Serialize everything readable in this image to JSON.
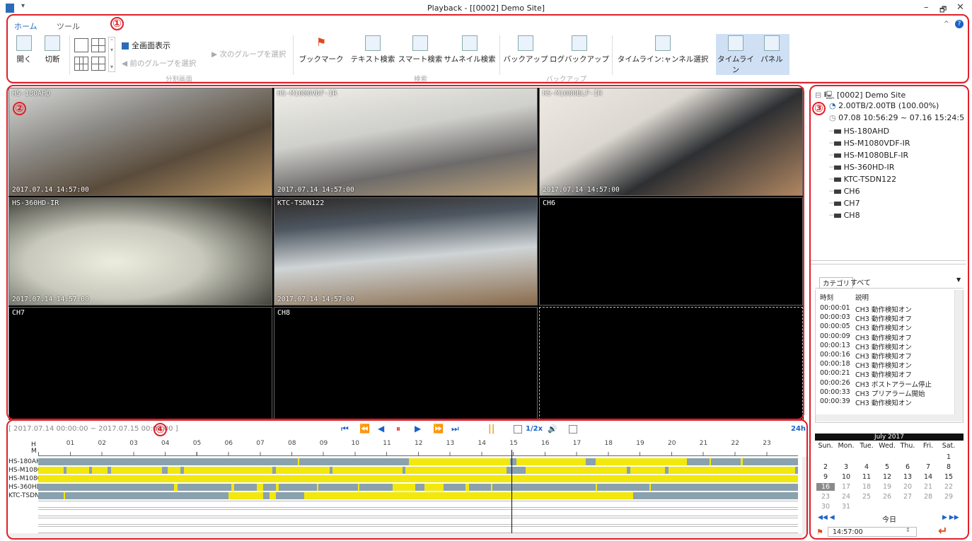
{
  "window": {
    "title": "Playback - [[0002] Demo Site]",
    "qa": "▾",
    "min": "–",
    "max": "🗗",
    "close": "✕"
  },
  "tabs": [
    {
      "label": "ホーム"
    },
    {
      "label": "ツール"
    }
  ],
  "ribbon": {
    "open": "開く",
    "disconnect": "切断",
    "fullscreen": "全画面表示",
    "prev_group": "前のグループを選択",
    "next_group": "次のグループを選択",
    "split_group": "分割画面",
    "bookmark": "ブックマーク",
    "text_search": "テキスト検索",
    "smart_search": "スマート検索",
    "thumb_search": "サムネイル検索",
    "search_group": "検索",
    "backup": "バックアップ",
    "log_backup": "ログバックアップ",
    "backup_group": "バックアップ",
    "timeline_channel": "タイムライン:ャンネル選択",
    "timeline": "タイムライン",
    "panel": "パネル"
  },
  "markers": [
    "①",
    "②",
    "③",
    "④"
  ],
  "tiles": [
    {
      "name": "HS-180AHD",
      "ts": "2017.07.14 14:57:00"
    },
    {
      "name": "HS-M1080VDF-IR",
      "ts": "2017.07.14 14:57:00"
    },
    {
      "name": "HS-M1080BLF-IR",
      "ts": "2017.07.14 14:57:00"
    },
    {
      "name": "HS-360HD-IR",
      "ts": "2017.07.14 14:57:00"
    },
    {
      "name": "KTC-TSDN122",
      "ts": "2017.07.14 14:57:00"
    },
    {
      "name": "CH6",
      "ts": ""
    },
    {
      "name": "CH7",
      "ts": ""
    },
    {
      "name": "CH8",
      "ts": ""
    },
    {
      "name": "",
      "ts": ""
    }
  ],
  "tree": {
    "site": "[0002] Demo Site",
    "storage": "2.00TB/2.00TB (100.00%)",
    "range": "07.08 10:56:29 ~ 07.16 15:24:5",
    "cameras": [
      "HS-180AHD",
      "HS-M1080VDF-IR",
      "HS-M1080BLF-IR",
      "HS-360HD-IR",
      "KTC-TSDN122",
      "CH6",
      "CH7",
      "CH8"
    ]
  },
  "events": {
    "category_label": "カテゴリ",
    "category_value": "すべて",
    "col_time": "時刻",
    "col_desc": "説明",
    "rows": [
      {
        "t": "00:00:01",
        "d": "CH3 動作検知オン"
      },
      {
        "t": "00:00:03",
        "d": "CH3 動作検知オフ"
      },
      {
        "t": "00:00:05",
        "d": "CH3 動作検知オン"
      },
      {
        "t": "00:00:09",
        "d": "CH3 動作検知オフ"
      },
      {
        "t": "00:00:13",
        "d": "CH3 動作検知オン"
      },
      {
        "t": "00:00:16",
        "d": "CH3 動作検知オフ"
      },
      {
        "t": "00:00:18",
        "d": "CH3 動作検知オン"
      },
      {
        "t": "00:00:21",
        "d": "CH3 動作検知オフ"
      },
      {
        "t": "00:00:26",
        "d": "CH3 ポストアラーム停止"
      },
      {
        "t": "00:00:33",
        "d": "CH3 プリアラーム開始"
      },
      {
        "t": "00:00:39",
        "d": "CH3 動作検知オン"
      }
    ]
  },
  "calendar": {
    "month": "July 2017",
    "dows": [
      "Sun.",
      "Mon.",
      "Tue.",
      "Wed.",
      "Thu.",
      "Fri.",
      "Sat."
    ],
    "weeks": [
      [
        "",
        "",
        "",
        "",
        "",
        "",
        "1"
      ],
      [
        "2",
        "3",
        "4",
        "5",
        "6",
        "7",
        "8"
      ],
      [
        "9",
        "10",
        "11",
        "12",
        "13",
        "14",
        "15"
      ],
      [
        "16",
        "17",
        "18",
        "19",
        "20",
        "21",
        "22"
      ],
      [
        "23",
        "24",
        "25",
        "26",
        "27",
        "28",
        "29"
      ],
      [
        "30",
        "31",
        "",
        "",
        "",
        "",
        ""
      ]
    ],
    "selected": "16",
    "today": "今日",
    "time": "14:57:00"
  },
  "playback": {
    "range": "[ 2017.07.14 00:00:00 ~ 2017.07.15 00:00:00 ]",
    "speed": "1/2x",
    "span": "24h",
    "buttons": [
      "⏮",
      "⏪",
      "◀",
      "⏸",
      "▶",
      "⏩",
      "⏭"
    ]
  },
  "timeline": {
    "hm_h": "H",
    "hm_m": "M",
    "hours": [
      "01",
      "02",
      "03",
      "04",
      "05",
      "06",
      "07",
      "08",
      "09",
      "10",
      "11",
      "12",
      "13",
      "14",
      "15",
      "16",
      "17",
      "18",
      "19",
      "20",
      "21",
      "22",
      "23"
    ],
    "tracks": [
      {
        "label": "HS-180AHD",
        "segs": [
          [
            8.2,
            8.25
          ],
          [
            11.7,
            14.9
          ],
          [
            15.1,
            17.3
          ],
          [
            17.6,
            20.5
          ],
          [
            21.2,
            21.25
          ],
          [
            22.2,
            22.25
          ]
        ]
      },
      {
        "label": "HS-M1080VDF-IR",
        "segs": [
          [
            0,
            0.8
          ],
          [
            0.9,
            1.6
          ],
          [
            1.7,
            2.2
          ],
          [
            2.3,
            3.9
          ],
          [
            4.1,
            4.5
          ],
          [
            4.6,
            7.4
          ],
          [
            7.5,
            9.2
          ],
          [
            9.3,
            11.5
          ],
          [
            11.6,
            14.8
          ],
          [
            15.4,
            18.6
          ],
          [
            18.7,
            19.8
          ],
          [
            19.9,
            23.9
          ]
        ]
      },
      {
        "label": "HS-M1080BLF-IR",
        "segs": [
          [
            0,
            24
          ]
        ]
      },
      {
        "label": "HS-360HD-IR",
        "segs": [
          [
            4.3,
            4.4
          ],
          [
            6.1,
            6.2
          ],
          [
            6.9,
            7.1
          ],
          [
            7.5,
            7.6
          ],
          [
            8.8,
            8.85
          ],
          [
            10.1,
            10.15
          ],
          [
            11.2,
            11.9
          ],
          [
            12.2,
            12.8
          ],
          [
            13.5,
            13.6
          ],
          [
            14.3,
            14.35
          ],
          [
            17.6,
            17.65
          ],
          [
            19.3,
            19.35
          ]
        ]
      },
      {
        "label": "KTC-TSDN122",
        "segs": [
          [
            0.8,
            0.85
          ],
          [
            6.0,
            7.1
          ],
          [
            7.3,
            7.5
          ],
          [
            8.4,
            18.8
          ]
        ]
      }
    ],
    "empty_tracks": 4,
    "playhead_hour": 14.95
  }
}
